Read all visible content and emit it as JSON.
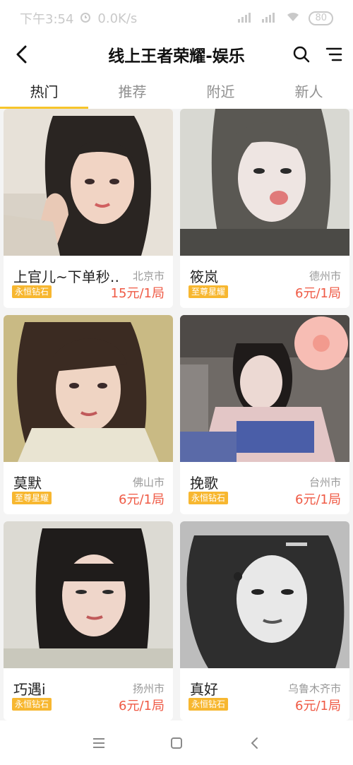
{
  "status": {
    "time": "下午3:54",
    "speed": "0.0K/s",
    "battery": "80"
  },
  "header": {
    "title": "线上王者荣耀-娱乐"
  },
  "tabs": [
    "热门",
    "推荐",
    "附近",
    "新人"
  ],
  "cards": [
    {
      "name": "上官儿~下单秒…",
      "city": "北京市",
      "badge": "永恒钻石",
      "price": "15元/1局"
    },
    {
      "name": "筱岚",
      "city": "德州市",
      "badge": "至尊星耀",
      "price": "6元/1局"
    },
    {
      "name": "莫默",
      "city": "佛山市",
      "badge": "至尊星耀",
      "price": "6元/1局"
    },
    {
      "name": "挽歌",
      "city": "台州市",
      "badge": "永恒钻石",
      "price": "6元/1局"
    },
    {
      "name": "巧遇i",
      "city": "扬州市",
      "badge": "永恒钻石",
      "price": "6元/1局"
    },
    {
      "name": "真好",
      "city": "乌鲁木齐市",
      "badge": "永恒钻石",
      "price": "6元/1局"
    }
  ],
  "colors": {
    "accent": "#f7c52a",
    "price": "#ef5a45",
    "badge": "#f7b730"
  },
  "icons": {
    "back": "back-arrow-icon",
    "search": "search-icon",
    "filter": "filter-icon",
    "nav_menu": "menu-icon",
    "nav_home": "home-square-icon",
    "nav_back": "nav-back-icon"
  }
}
